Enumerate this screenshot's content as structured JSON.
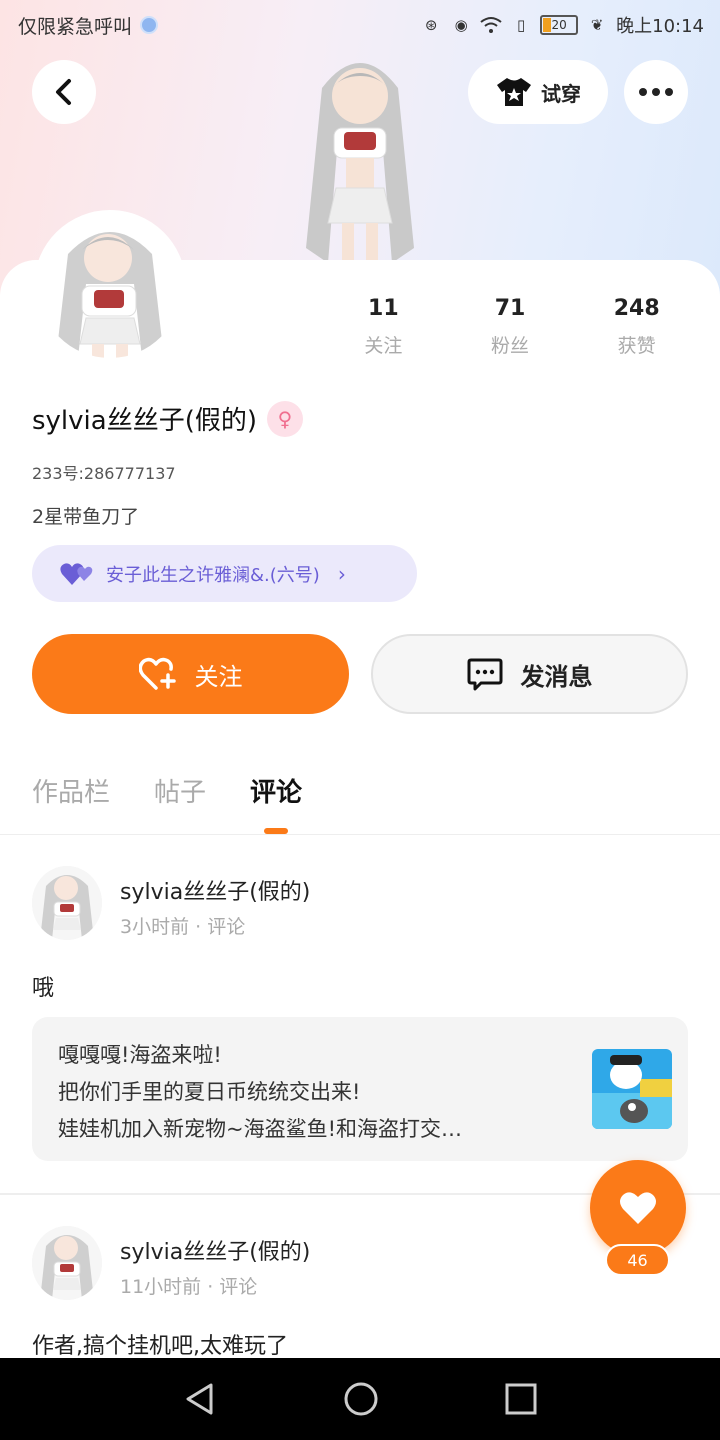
{
  "status_bar": {
    "left_text": "仅限紧急呼叫",
    "battery": "20",
    "time": "晚上10:14"
  },
  "header": {
    "try_on_label": "试穿"
  },
  "profile": {
    "stats": [
      {
        "value": "11",
        "label": "关注"
      },
      {
        "value": "71",
        "label": "粉丝"
      },
      {
        "value": "248",
        "label": "获赞"
      }
    ],
    "name": "sylvia丝丝子(假的)",
    "gender_symbol": "♀",
    "uid": "233号:286777137",
    "bio": "2星带鱼刀了",
    "tag_pill": "安子此生之许雅澜&.(六号)",
    "follow_label": "关注",
    "message_label": "发消息"
  },
  "tabs": [
    {
      "label": "作品栏",
      "active": false
    },
    {
      "label": "帖子",
      "active": false
    },
    {
      "label": "评论",
      "active": true
    }
  ],
  "posts": [
    {
      "name": "sylvia丝丝子(假的)",
      "meta": "3小时前 · 评论",
      "text": "哦",
      "quote": [
        "嘎嘎嘎!海盗来啦!",
        "把你们手里的夏日币统统交出来!",
        "娃娃机加入新宠物~海盗鲨鱼!和海盗打交…"
      ]
    },
    {
      "name": "sylvia丝丝子(假的)",
      "meta": "11小时前 · 评论",
      "text": "作者,搞个挂机吧,太难玩了"
    }
  ],
  "like_fab": {
    "count": "46"
  },
  "colors": {
    "accent": "#fb7a18",
    "tag_bg": "#ebe9fb",
    "tag_text": "#6a5ed6"
  }
}
